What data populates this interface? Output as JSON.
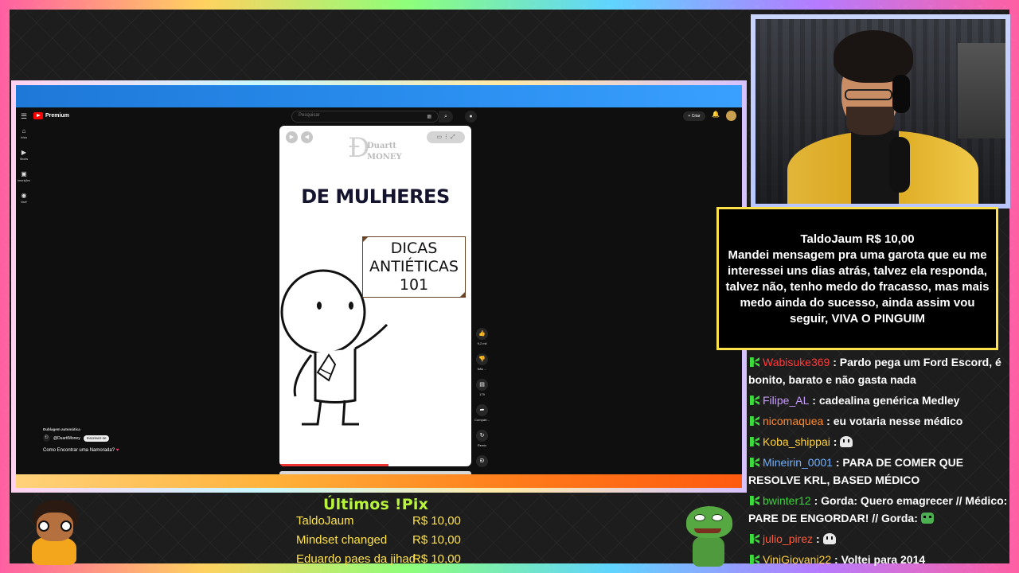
{
  "youtube": {
    "brand": "Premium",
    "search_placeholder": "Pesquisar",
    "create_label": "+ Criar",
    "sidebar": [
      {
        "icon": "home-icon",
        "label": "Início"
      },
      {
        "icon": "shorts-icon",
        "label": "Shorts"
      },
      {
        "icon": "subscriptions-icon",
        "label": "Inscrições"
      },
      {
        "icon": "you-icon",
        "label": "Você"
      }
    ],
    "short": {
      "brand_line1": "Duartt",
      "brand_line2": "MONEY",
      "headline": "DE MULHERES",
      "board_lines": [
        "DICAS",
        "ANTIÉTICAS",
        "101"
      ],
      "dubbing": "Dublagem automática",
      "channel": "@DuarttMoney",
      "subscribe": "Inscrever-se",
      "title": "Como Encontrar uma Namorada?",
      "progress_fraction": 0.57
    },
    "actions": [
      {
        "icon": "like-icon",
        "label": "9,2 mil"
      },
      {
        "icon": "dislike-icon",
        "label": "Não ..."
      },
      {
        "icon": "comment-icon",
        "label": "179"
      },
      {
        "icon": "share-icon",
        "label": "Compart..."
      },
      {
        "icon": "remix-icon",
        "label": "Remix"
      }
    ]
  },
  "alert": {
    "header": "TaldoJaum R$ 10,00",
    "message": "Mandei mensagem pra uma garota que eu me interessei uns dias atrás, talvez ela responda, talvez não, tenho medo do fracasso, mas mais medo ainda do sucesso, ainda assim vou seguir, VIVA O PINGUIM"
  },
  "chat": [
    {
      "user": "Wabisuke369",
      "color": "#ff3b3b",
      "text": ": Pardo pega um Ford Escord, é bonito, barato e não gasta nada"
    },
    {
      "user": "Filipe_AL",
      "color": "#c89bff",
      "text": ": cadealina genérica Medley"
    },
    {
      "user": "nicomaquea",
      "color": "#ff8a2a",
      "text": ": eu votaria nesse médico"
    },
    {
      "user": "Koba_shippai",
      "color": "#ffd23a",
      "text": ":",
      "emote": "ghost"
    },
    {
      "user": "Mineirin_0001",
      "color": "#6fb0ff",
      "text": ": PARA DE COMER QUE RESOLVE KRL, BASED MÉDICO"
    },
    {
      "user": "bwinter12",
      "color": "#3ad43a",
      "text": ": Gorda: Quero emagrecer // Médico: PARE DE ENGORDAR! // Gorda:",
      "emote": "frog"
    },
    {
      "user": "julio_pirez",
      "color": "#ff5a3a",
      "text": ":",
      "emote": "ghost"
    },
    {
      "user": "ViniGiovani22",
      "color": "#ffd23a",
      "text": ": Voltei para 2014"
    }
  ],
  "pix": {
    "title": "Últimos !Pix",
    "rows": [
      {
        "name": "TaldoJaum",
        "value": "R$ 10,00"
      },
      {
        "name": "Mindset changed",
        "value": "R$ 10,00"
      },
      {
        "name": "Eduardo paes da jihad",
        "value": "R$ 10,00"
      }
    ]
  },
  "colors": {
    "pix_title": "#b9f53a",
    "pix_rows": "#ffe24a",
    "alert_border": "#ffe14a",
    "chat_badge": "#3adb3a"
  }
}
